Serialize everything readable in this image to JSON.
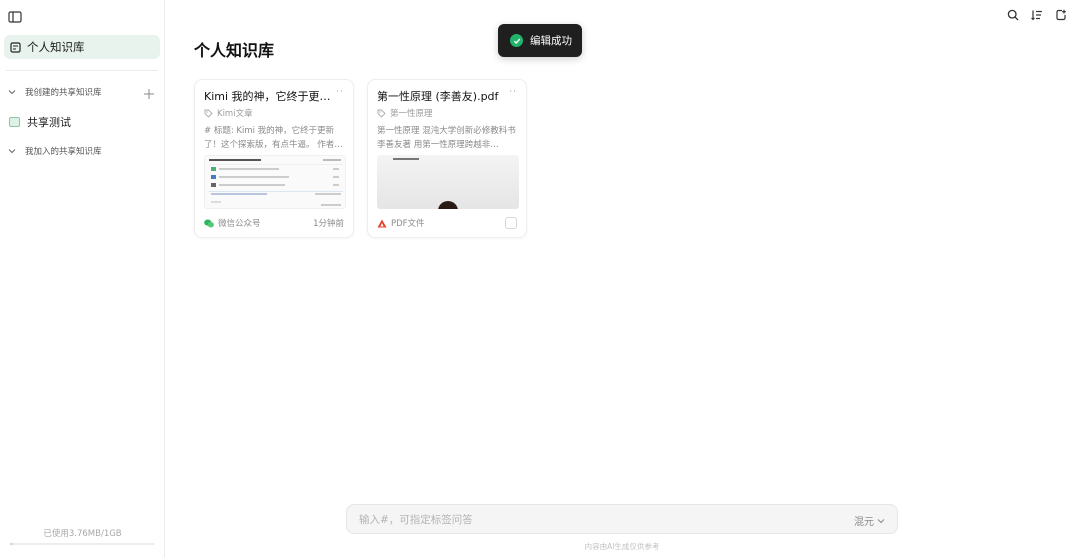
{
  "sidebar": {
    "active_item": "个人知识库",
    "section_created": "我创建的共享知识库",
    "shared_kb": "共享测试",
    "section_joined": "我加入的共享知识库",
    "usage": "已使用3.76MB/1GB",
    "usage_fraction": 0.004
  },
  "main": {
    "title": "个人知识库"
  },
  "toast": {
    "text": "编辑成功"
  },
  "cards": [
    {
      "title": "Kimi 我的神，它终于更新…",
      "more": "··",
      "tag": "Kimi文章",
      "desc": "# 标题: Kimi 我的神，它终于更新了！这个探索版，有点牛逼。 作者…",
      "source": "微信公众号",
      "time": "1分钟前"
    },
    {
      "title": "第一性原理 (李善友).pdf",
      "more": "··",
      "tag": "第一性原理",
      "desc": "第一性原理 混沌大学创新必修教科书 李善友著 用第一性原理跨越非…",
      "source": "PDF文件"
    }
  ],
  "ask": {
    "placeholder": "输入#，可指定标签问答",
    "mode": "混元"
  },
  "footnote": "内容由AI生成仅供参考",
  "colors": {
    "accent_green": "#22b36b",
    "active_bg": "#e8f3ee",
    "pdf_red": "#e5412d"
  }
}
